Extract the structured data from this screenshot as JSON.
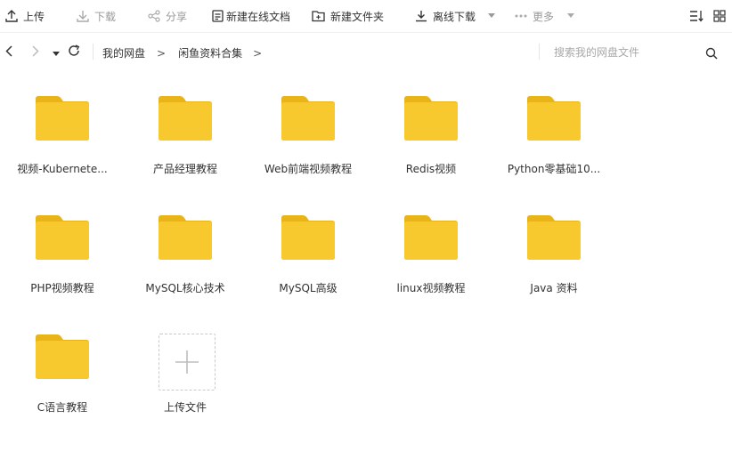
{
  "toolbar": {
    "upload": "上传",
    "download": "下载",
    "share": "分享",
    "new_doc": "新建在线文档",
    "new_folder": "新建文件夹",
    "offline_download": "离线下载",
    "more": "更多"
  },
  "nav": {
    "breadcrumbs": [
      "我的网盘",
      "闲鱼资料合集"
    ],
    "separator": ">"
  },
  "search": {
    "placeholder": "搜索我的网盘文件"
  },
  "files": [
    {
      "name": "视频-Kubernete..."
    },
    {
      "name": "产品经理教程"
    },
    {
      "name": "Web前端视频教程"
    },
    {
      "name": "Redis视频"
    },
    {
      "name": "Python零基础10..."
    },
    {
      "name": "PHP视频教程"
    },
    {
      "name": "MySQL核心技术"
    },
    {
      "name": "MySQL高级"
    },
    {
      "name": "linux视频教程"
    },
    {
      "name": "Java 资料"
    },
    {
      "name": "C语言教程"
    }
  ],
  "upload_tile": {
    "label": "上传文件"
  },
  "colors": {
    "folder_body": "#F8C92E",
    "folder_tab": "#E9B418",
    "text": "#333333",
    "disabled": "#999999"
  }
}
